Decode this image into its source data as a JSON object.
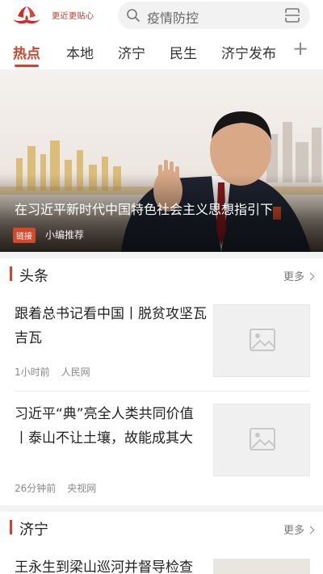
{
  "header": {
    "logo_tagline": "更近更贴心",
    "search_text": "疫情防控"
  },
  "tabs": [
    {
      "label": "热点"
    },
    {
      "label": "本地"
    },
    {
      "label": "济宁"
    },
    {
      "label": "民生"
    },
    {
      "label": "济宁发布"
    }
  ],
  "tab_plus": "+",
  "banner": {
    "title": "在习近平新时代中国特色社会主义思想指引下",
    "badge": "链接",
    "source": "小编推荐"
  },
  "headlines": {
    "title": "头条",
    "more": "更多",
    "items": [
      {
        "title": "跟着总书记看中国丨脱贫攻坚瓦吉瓦",
        "time": "1小时前",
        "source": "人民网"
      },
      {
        "title": "习近平“典”亮全人类共同价值丨泰山不让土壤，故能成其大",
        "time": "26分钟前",
        "source": "央视网"
      }
    ]
  },
  "jining": {
    "title": "济宁",
    "more": "更多",
    "items": [
      {
        "title": "王永生到梁山巡河并督导检查"
      }
    ]
  },
  "colors": {
    "accent": "#c9472b",
    "badge": "#d24a2a"
  }
}
